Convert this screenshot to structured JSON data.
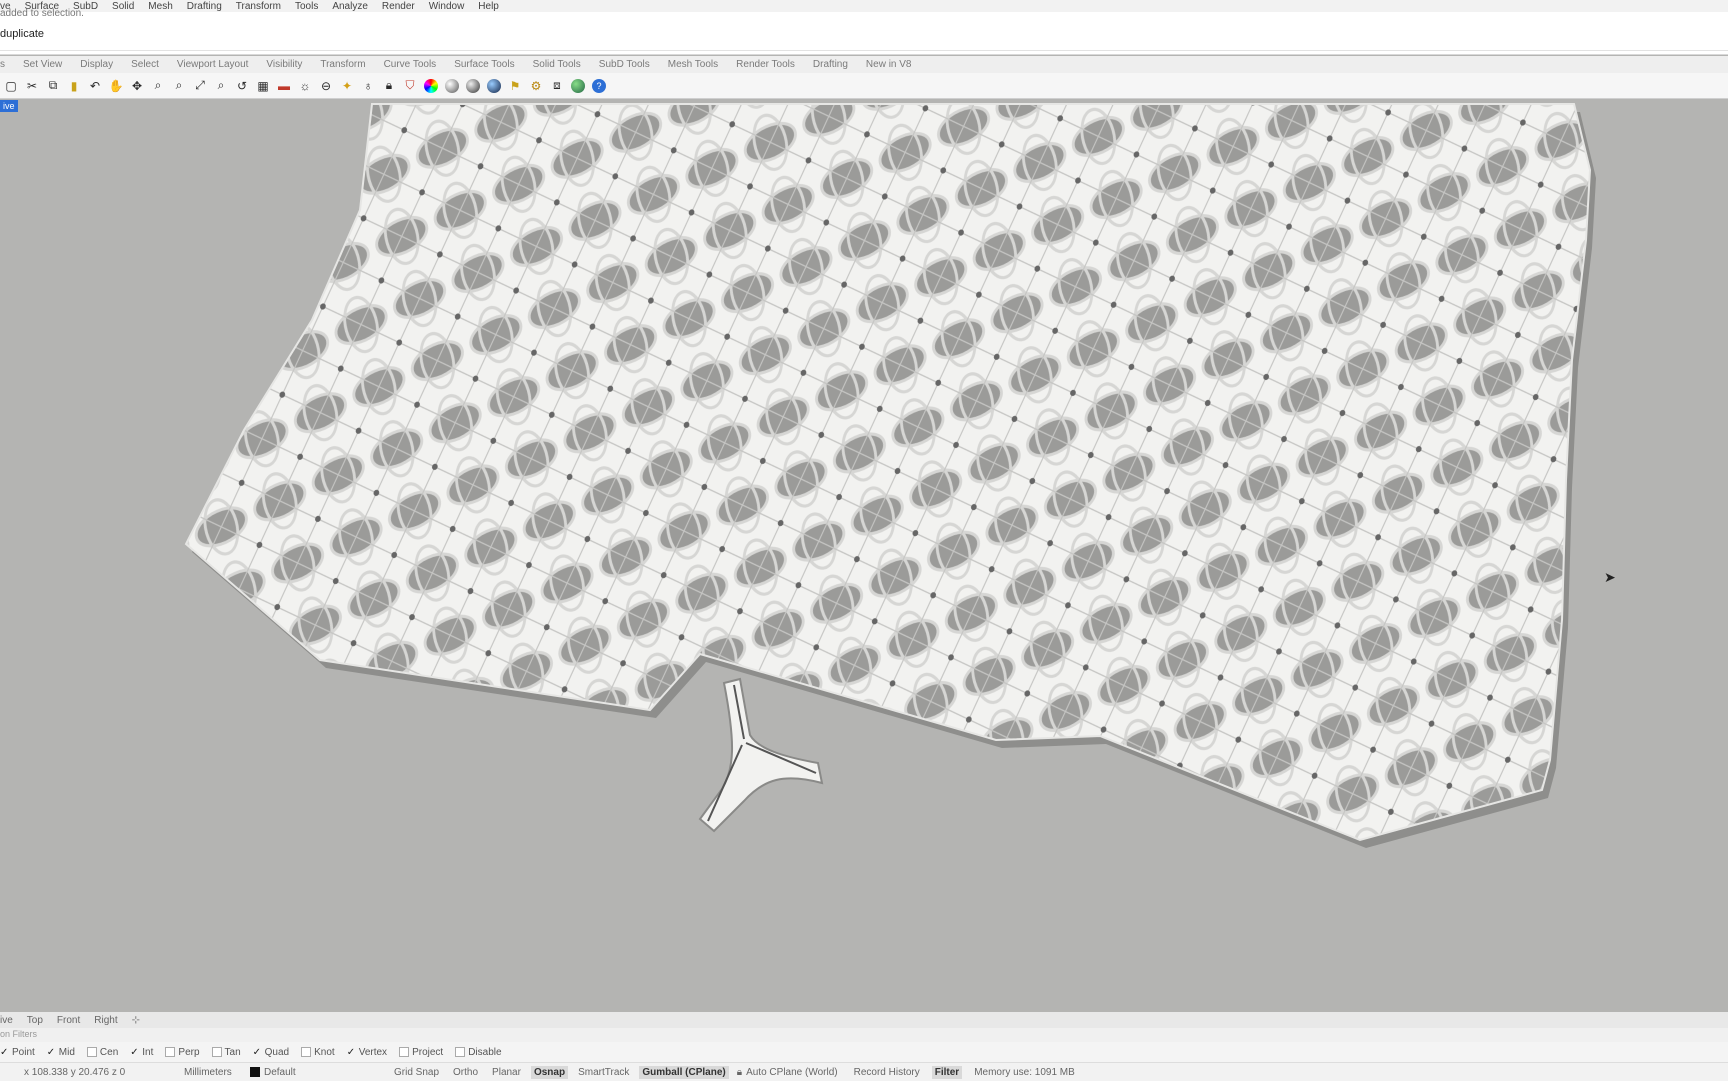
{
  "menu": [
    "ve",
    "Surface",
    "SubD",
    "Solid",
    "Mesh",
    "Drafting",
    "Transform",
    "Tools",
    "Analyze",
    "Render",
    "Window",
    "Help"
  ],
  "command": {
    "history": "added to selection.",
    "prompt": "duplicate"
  },
  "tabs": [
    "s",
    "Set View",
    "Display",
    "Select",
    "Viewport Layout",
    "Visibility",
    "Transform",
    "Curve Tools",
    "Surface Tools",
    "Solid Tools",
    "SubD Tools",
    "Mesh Tools",
    "Render Tools",
    "Drafting",
    "New in V8"
  ],
  "toolbar_icons": [
    "new-icon",
    "cut-icon",
    "copy-icon",
    "paste-icon",
    "undo-icon",
    "pan-icon",
    "rotate-view-icon",
    "zoom-icon",
    "zoom-window-icon",
    "zoom-extents-icon",
    "zoom-selected-icon",
    "undo-view-icon",
    "grid-icon",
    "section-icon",
    "lights-icon",
    "cplane-icon",
    "snapshot-icon",
    "lightbulb-icon",
    "lock-icon",
    "filter-icon",
    "color-wheel-icon",
    "wireframe-sphere-icon",
    "shaded-sphere-icon",
    "rendered-sphere-icon",
    "object-props-icon",
    "gear-icon",
    "layers-icon",
    "globe-icon",
    "help-icon"
  ],
  "viewport": {
    "label": "ive"
  },
  "view_tabs": [
    "ive",
    "Top",
    "Front",
    "Right",
    "⊹"
  ],
  "filters_label": "on Filters",
  "osnap": [
    {
      "label": "Point",
      "checked": true
    },
    {
      "label": "Mid",
      "checked": true
    },
    {
      "label": "Cen",
      "checked": false
    },
    {
      "label": "Int",
      "checked": true
    },
    {
      "label": "Perp",
      "checked": false
    },
    {
      "label": "Tan",
      "checked": false
    },
    {
      "label": "Quad",
      "checked": true
    },
    {
      "label": "Knot",
      "checked": false
    },
    {
      "label": "Vertex",
      "checked": true
    },
    {
      "label": "Project",
      "checked": false
    },
    {
      "label": "Disable",
      "checked": false
    }
  ],
  "status": {
    "coords": "x 108.338   y 20.476   z 0",
    "units": "Millimeters",
    "layer": "Default",
    "grid_snap": "Grid Snap",
    "ortho": "Ortho",
    "planar": "Planar",
    "osnap": "Osnap",
    "smarttrack": "SmartTrack",
    "gumball": "Gumball (CPlane)",
    "auto_cplane": "Auto CPlane (World)",
    "record_history": "Record History",
    "filter": "Filter",
    "memory": "Memory use: 1091 MB"
  },
  "colors": {
    "viewport_bg": "#b4b4b2",
    "tile": "#f2f2f0",
    "accent": "#2d6fd6"
  }
}
